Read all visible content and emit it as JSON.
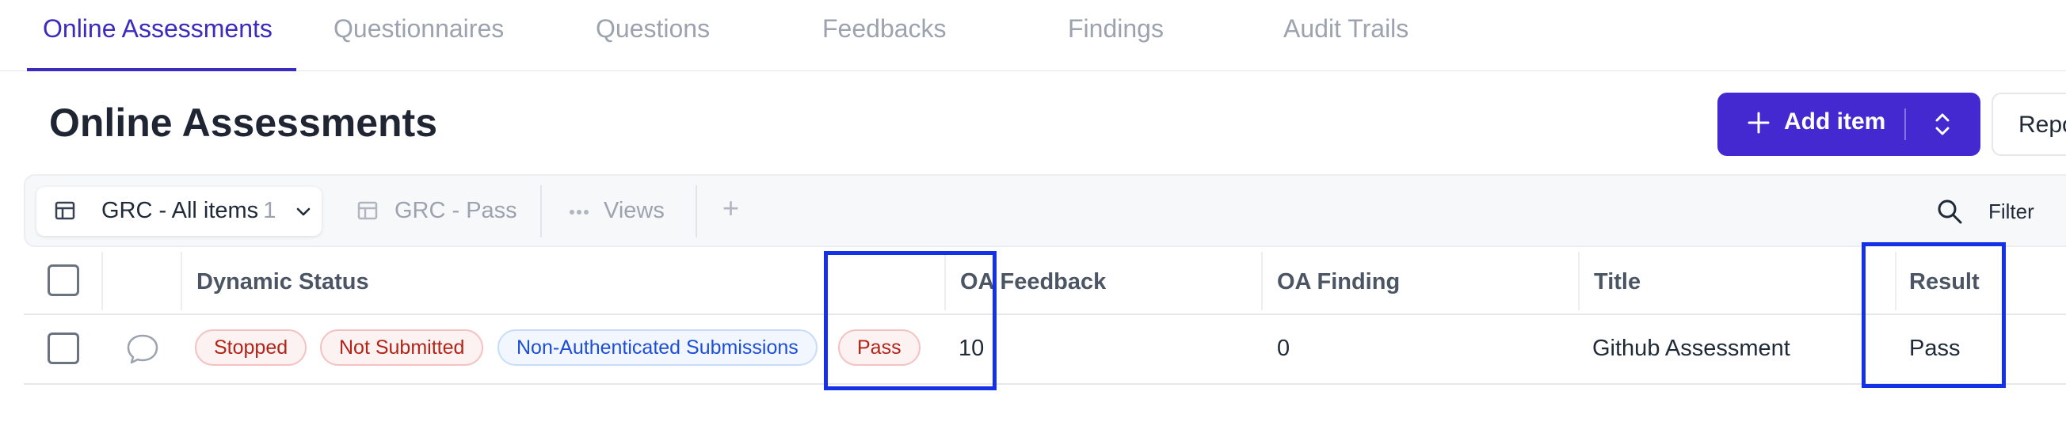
{
  "tabs": [
    {
      "label": "Online Assessments",
      "active": true
    },
    {
      "label": "Questionnaires",
      "active": false
    },
    {
      "label": "Questions",
      "active": false
    },
    {
      "label": "Feedbacks",
      "active": false
    },
    {
      "label": "Findings",
      "active": false
    },
    {
      "label": "Audit Trails",
      "active": false
    }
  ],
  "header": {
    "title": "Online Assessments",
    "add_button_label": "Add item",
    "report_button_label": "Repo"
  },
  "toolbar": {
    "active_view": {
      "label": "GRC - All items",
      "count": "1"
    },
    "other_view": "GRC - Pass",
    "views_label": "Views",
    "add_view_symbol": "+",
    "filter_label": "Filter"
  },
  "table": {
    "columns": {
      "dynamic_status": "Dynamic Status",
      "oa_feedback": "OA Feedback",
      "oa_finding": "OA Finding",
      "title": "Title",
      "result": "Result"
    },
    "rows": [
      {
        "status_badges": [
          "Stopped",
          "Not Submitted",
          "Non-Authenticated Submissions",
          "Pass"
        ],
        "oa_feedback": "10",
        "oa_finding": "0",
        "title": "Github Assessment",
        "result": "Pass"
      }
    ]
  },
  "colors": {
    "accent": "#4329cf",
    "highlight": "#1531e6",
    "badge_red": "#b42318",
    "badge_blue": "#1d4ed8"
  },
  "icons": [
    "table-icon",
    "chevron-down-icon",
    "dots-icon",
    "plus-icon",
    "search-icon",
    "comment-icon",
    "chevron-up-down-icon"
  ]
}
